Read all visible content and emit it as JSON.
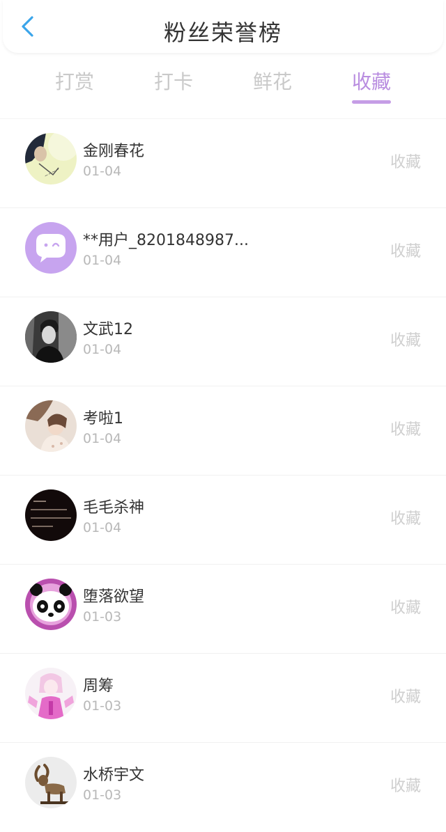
{
  "header": {
    "title": "粉丝荣誉榜",
    "back_icon": "chevron-left-icon",
    "accent_color": "#3ba5ea"
  },
  "tabs": [
    {
      "label": "打赏",
      "active": false
    },
    {
      "label": "打卡",
      "active": false
    },
    {
      "label": "鲜花",
      "active": false
    },
    {
      "label": "收藏",
      "active": true
    }
  ],
  "active_tab_color": "#b98de0",
  "fans": [
    {
      "name": "金刚春花",
      "date": "01-04",
      "action": "收藏",
      "avatar": "photo-avatar-pale-green"
    },
    {
      "name": "**用户_8201848987...",
      "date": "01-04",
      "action": "收藏",
      "avatar": "default-chat-bubble-avatar"
    },
    {
      "name": "文武12",
      "date": "01-04",
      "action": "收藏",
      "avatar": "photo-avatar-man-bw"
    },
    {
      "name": "考啦1",
      "date": "01-04",
      "action": "收藏",
      "avatar": "photo-avatar-girl"
    },
    {
      "name": "毛毛杀神",
      "date": "01-04",
      "action": "收藏",
      "avatar": "text-avatar-dark"
    },
    {
      "name": "堕落欲望",
      "date": "01-03",
      "action": "收藏",
      "avatar": "panda-avatar"
    },
    {
      "name": "周筹",
      "date": "01-03",
      "action": "收藏",
      "avatar": "anime-girl-avatar-pink"
    },
    {
      "name": "水桥宇文",
      "date": "01-03",
      "action": "收藏",
      "avatar": "goat-statue-avatar"
    }
  ]
}
